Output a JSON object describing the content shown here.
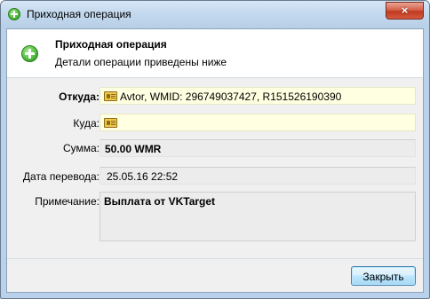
{
  "window": {
    "title": "Приходная операция",
    "close_glyph": "×"
  },
  "header": {
    "title": "Приходная операция",
    "subtitle": "Детали операции приведены ниже",
    "icon": "plus-circle-icon"
  },
  "form": {
    "from": {
      "label": "Откуда:",
      "value": "Avtor, WMID: 296749037427, R151526190390",
      "icon": "wmid-card-icon"
    },
    "to": {
      "label": "Куда:",
      "value": "",
      "icon": "wmid-card-icon"
    },
    "amount": {
      "label": "Сумма:",
      "value": "50.00 WMR"
    },
    "date": {
      "label": "Дата перевода:",
      "value": "25.05.16 22:52"
    },
    "note": {
      "label": "Примечание:",
      "value": "Выплата от VKTarget"
    }
  },
  "footer": {
    "close_label": "Закрыть"
  },
  "colors": {
    "field_highlight": "#ffffe1",
    "readonly_field": "#ececec",
    "icon_green": "#3fae2c",
    "close_button_red": "#c0391f"
  }
}
